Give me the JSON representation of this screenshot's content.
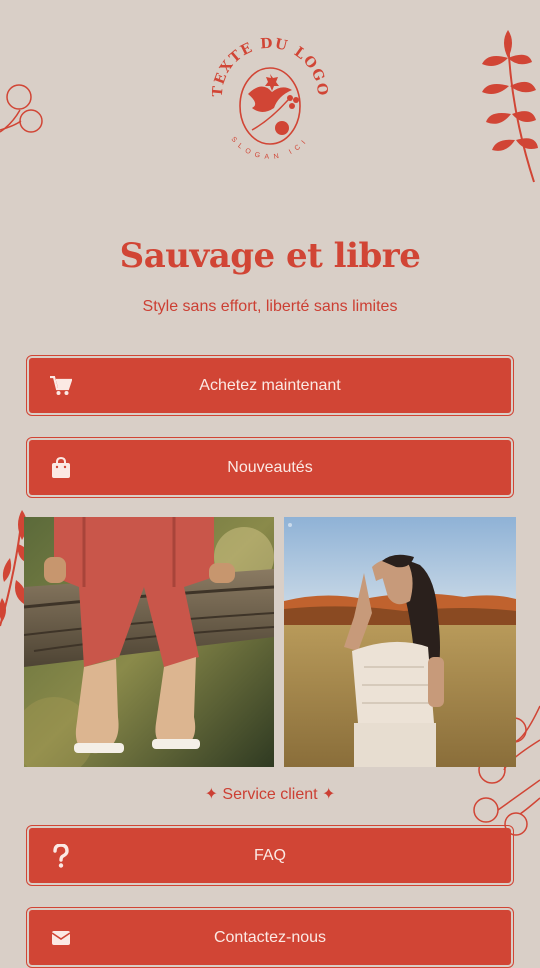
{
  "brand": {
    "logo_top_text": "TEXTE DU LOGO",
    "logo_bottom_text": "SLOGAN ICI"
  },
  "hero": {
    "title": "Sauvage et libre",
    "subtitle": "Style sans effort, liberté sans limites"
  },
  "buttons": [
    {
      "label": "Achetez maintenant",
      "icon": "shopping-cart-icon"
    },
    {
      "label": "Nouveautés",
      "icon": "shopping-bag-icon"
    }
  ],
  "service": {
    "heading": "✦ Service client ✦",
    "buttons": [
      {
        "label": "FAQ",
        "icon": "question-icon"
      },
      {
        "label": "Contactez-nous",
        "icon": "envelope-icon"
      }
    ]
  },
  "colors": {
    "background": "#d9cfc7",
    "accent": "#d14535",
    "button_text": "#fbe9e4"
  }
}
